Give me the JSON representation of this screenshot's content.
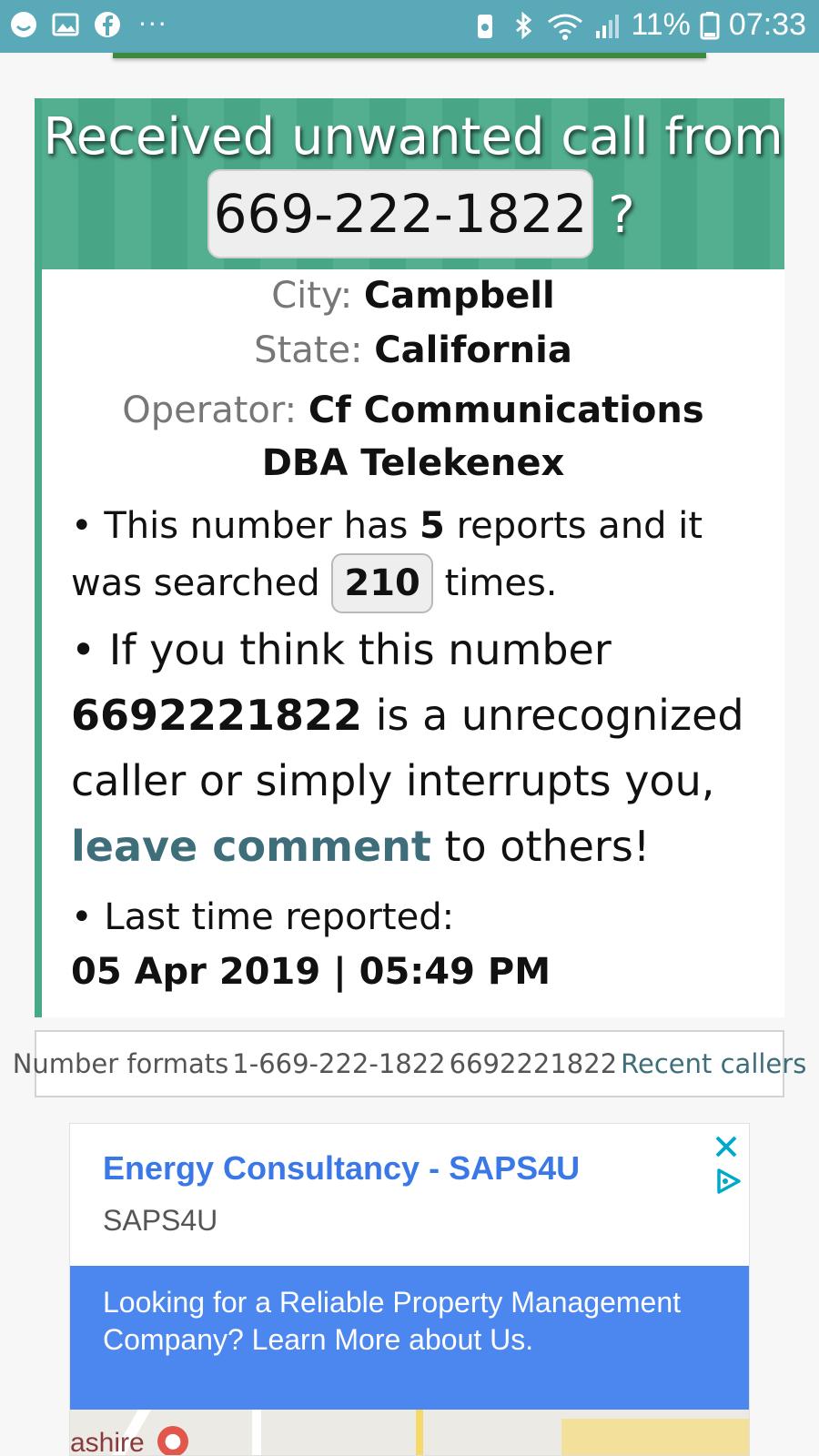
{
  "status_bar": {
    "left_icons": [
      "smiley-icon",
      "image-icon",
      "facebook-icon",
      "more-dots-icon"
    ],
    "more": "···",
    "battery_percent": "11%",
    "time": "07:33"
  },
  "header": {
    "title": "Received unwanted call from",
    "phone": "669-222-1822",
    "question_mark": "?"
  },
  "info": {
    "city_label": "City:",
    "city": "Campbell",
    "state_label": "State:",
    "state": "California",
    "operator_label": "Operator:",
    "operator": "Cf Communications DBA Telekenex"
  },
  "reports": {
    "bullet": "•",
    "text1": "This number has",
    "count": "5",
    "text2": "reports and it was searched",
    "searched": "210",
    "text3": "times."
  },
  "comment": {
    "bullet": "•",
    "text1": "If you think this number",
    "number": "6692221822",
    "text2": "is a unrecognized caller or simply interrupts you,",
    "link": "leave comment",
    "text3": "to others!"
  },
  "last_report": {
    "bullet": "•",
    "label": "Last time reported:",
    "value": "05 Apr 2019 | 05:49 PM"
  },
  "formats": {
    "label": "Number formats",
    "format1": "1-669-222-1822",
    "format2": "6692221822",
    "recent": "Recent callers"
  },
  "ad": {
    "title": "Energy Consultancy - SAPS4U",
    "advertiser": "SAPS4U",
    "body": "Looking for a Reliable Property Management Company? Learn More about Us.",
    "map_label": "ashire"
  },
  "colors": {
    "status_bar": "#5aa9b8",
    "header_green": "#4aab8a",
    "link": "#3d6e7a",
    "ad_blue": "#4b87ee"
  }
}
